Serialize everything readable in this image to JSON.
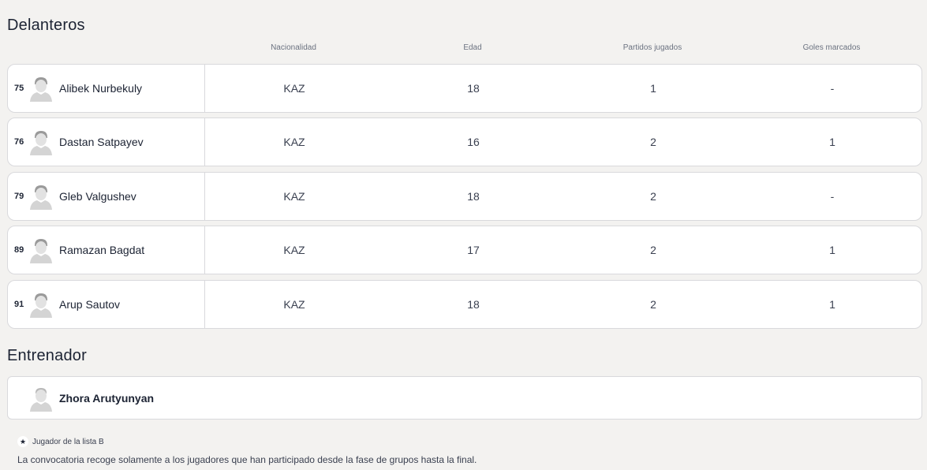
{
  "sections": {
    "forwards_title": "Delanteros",
    "coach_title": "Entrenador"
  },
  "columns": {
    "nationality": "Nacionalidad",
    "age": "Edad",
    "matches": "Partidos jugados",
    "goals": "Goles marcados"
  },
  "players": [
    {
      "number": "75",
      "name": "Alibek Nurbekuly",
      "nationality": "KAZ",
      "age": "18",
      "matches": "1",
      "goals": "-"
    },
    {
      "number": "76",
      "name": "Dastan Satpayev",
      "nationality": "KAZ",
      "age": "16",
      "matches": "2",
      "goals": "1"
    },
    {
      "number": "79",
      "name": "Gleb Valgushev",
      "nationality": "KAZ",
      "age": "18",
      "matches": "2",
      "goals": "-"
    },
    {
      "number": "89",
      "name": "Ramazan Bagdat",
      "nationality": "KAZ",
      "age": "17",
      "matches": "2",
      "goals": "1"
    },
    {
      "number": "91",
      "name": "Arup Sautov",
      "nationality": "KAZ",
      "age": "18",
      "matches": "2",
      "goals": "1"
    }
  ],
  "coach": {
    "name": "Zhora Arutyunyan"
  },
  "legend": {
    "icon": "star-icon",
    "star": "★",
    "text": "Jugador de la lista B"
  },
  "footnote": "La convocatoria recoge solamente a los jugadores que han participado desde la fase de grupos hasta la final."
}
